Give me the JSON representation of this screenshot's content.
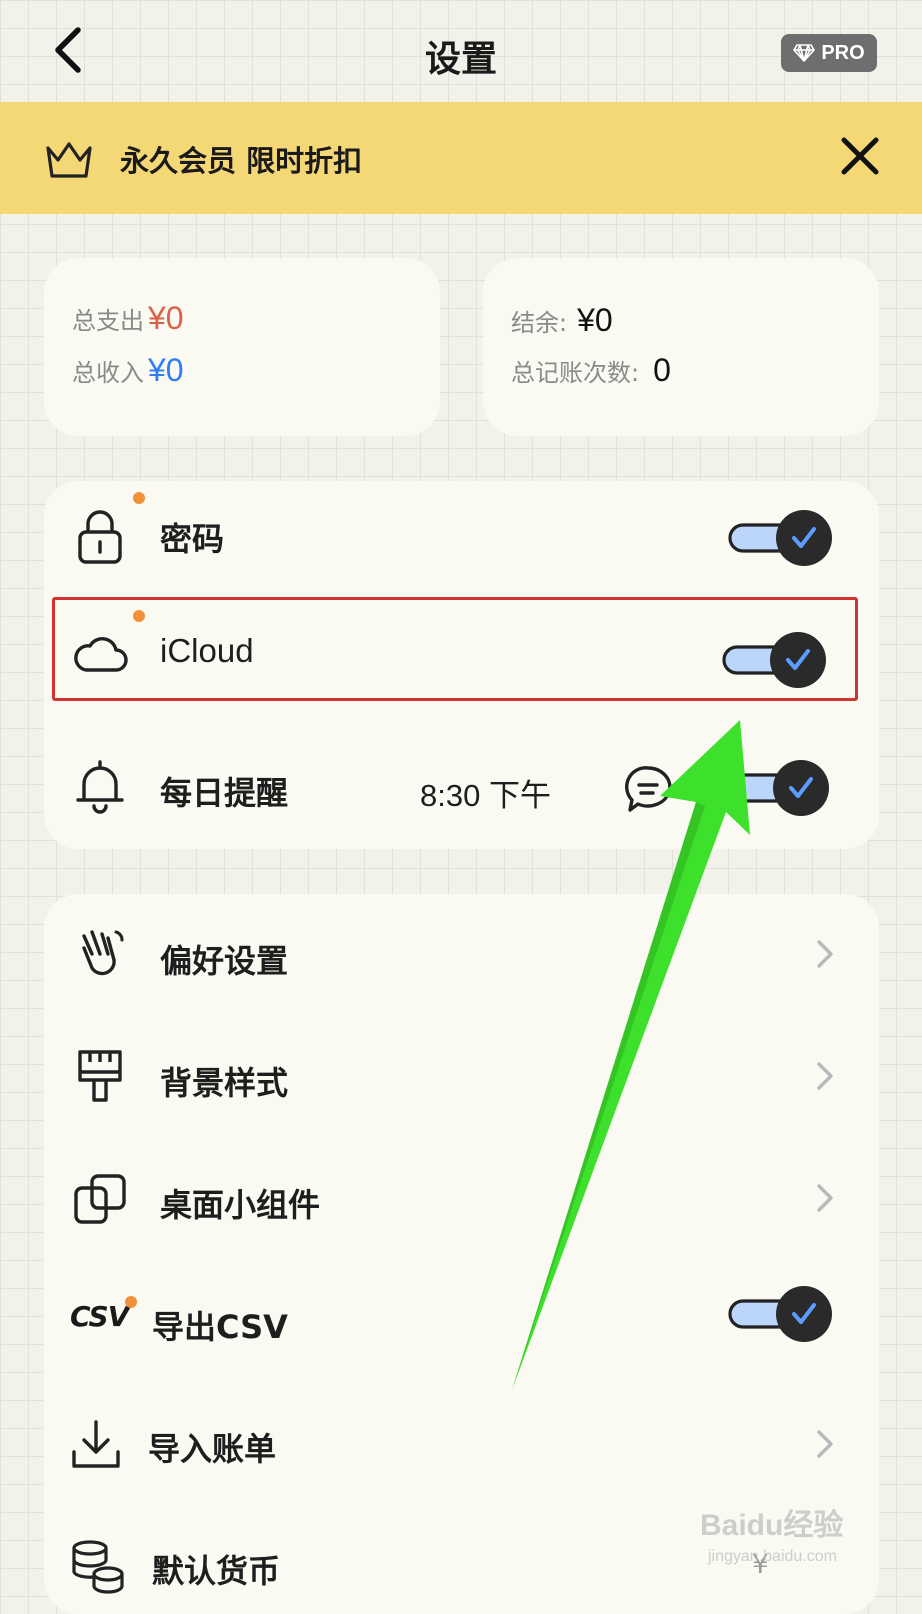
{
  "header": {
    "title": "设置",
    "pro_badge": "PRO"
  },
  "banner": {
    "text": "永久会员 限时折扣"
  },
  "stats": {
    "expense_label": "总支出",
    "expense_value": "¥0",
    "income_label": "总收入",
    "income_value": "¥0",
    "balance_label": "结余:",
    "balance_value": "¥0",
    "count_label": "总记账次数:",
    "count_value": "0"
  },
  "group1": {
    "password": {
      "label": "密码",
      "enabled": true
    },
    "icloud": {
      "label": "iCloud",
      "enabled": true
    },
    "reminder": {
      "label": "每日提醒",
      "time": "8:30 下午",
      "enabled": true
    }
  },
  "group2": {
    "preferences": {
      "label": "偏好设置"
    },
    "background": {
      "label": "背景样式"
    },
    "widgets": {
      "label": "桌面小组件"
    },
    "export_csv": {
      "label": "导出CSV",
      "icon_text": "CSV",
      "enabled": true
    },
    "import": {
      "label": "导入账单"
    },
    "currency": {
      "label": "默认货币",
      "value": "¥"
    }
  },
  "watermark": {
    "text": "Baidu经验",
    "sub": "jingyan.baidu.com"
  },
  "colors": {
    "accent_banner": "#f5d876",
    "dot": "#f0923a",
    "toggle_check": "#2f7cf6",
    "highlight": "#d23232",
    "arrow": "#3de12b"
  }
}
